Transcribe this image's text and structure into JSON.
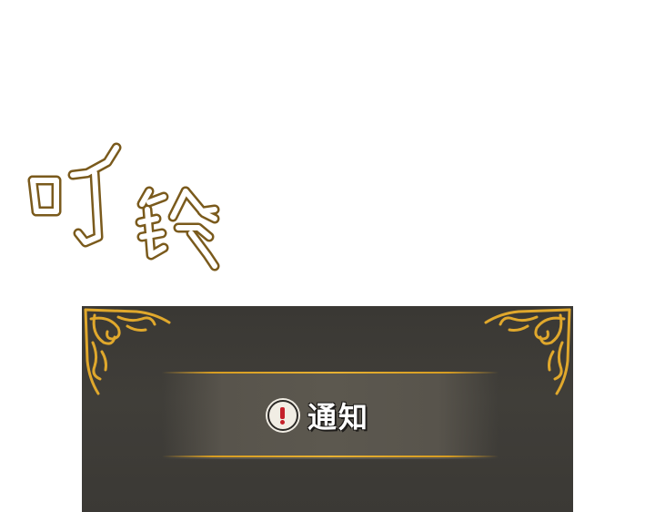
{
  "sound_effect": {
    "text": "叮铃",
    "fill_color": "#ffffff",
    "outline_color": "#7a5a1c"
  },
  "notification": {
    "icon": "exclamation-icon",
    "title": "通知",
    "accent_color": "#e0a82c",
    "panel_color": "#3d3b37"
  }
}
